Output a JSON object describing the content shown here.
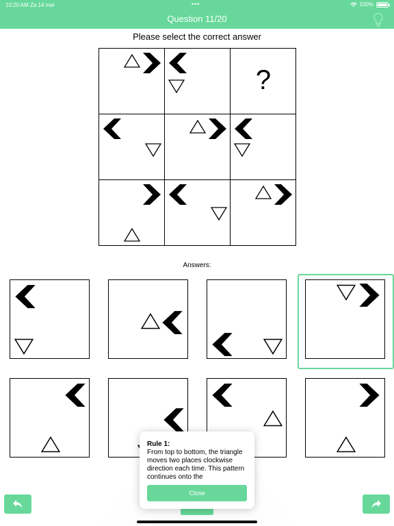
{
  "status_bar": {
    "time": "10:20 AM",
    "date": "Za 14 mei",
    "dots": "•••",
    "battery": "100%",
    "battery_level": 1.0,
    "wifi_icon": "wifi-icon"
  },
  "header": {
    "title": "Question 11/20",
    "hint_icon": "lightbulb-icon"
  },
  "prompt": "Please select the correct answer",
  "grid": {
    "missing_mark": "?"
  },
  "answers": {
    "label": "Answers:",
    "selected_index": 3
  },
  "popup": {
    "title": "Rule 1:",
    "text": "From top to bottom, the triangle moves two places clockwise direction each time. This pattern continues onto the",
    "close_label": "Close"
  },
  "navigation": {
    "back_icon": "arrow-back-icon",
    "forward_icon": "arrow-forward-icon"
  },
  "colors": {
    "accent": "#67d89a",
    "text": "#000000",
    "background": "#ffffff"
  }
}
